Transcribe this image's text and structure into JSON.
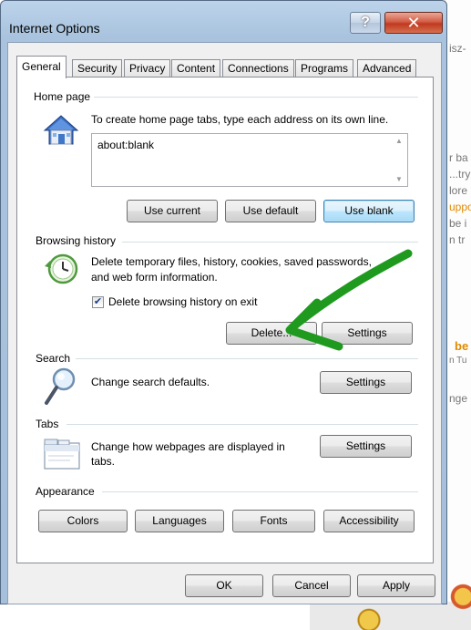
{
  "window": {
    "title": "Internet Options",
    "help_glyph": "?",
    "close_glyph": "✕"
  },
  "tabs": [
    {
      "label": "General",
      "active": true
    },
    {
      "label": "Security"
    },
    {
      "label": "Privacy"
    },
    {
      "label": "Content"
    },
    {
      "label": "Connections"
    },
    {
      "label": "Programs"
    },
    {
      "label": "Advanced"
    }
  ],
  "home_page": {
    "label": "Home page",
    "description": "To create home page tabs, type each address on its own line.",
    "address_value": "about:blank",
    "use_current": "Use current",
    "use_default": "Use default",
    "use_blank": "Use blank"
  },
  "browsing_history": {
    "label": "Browsing history",
    "description_line1": "Delete temporary files, history, cookies, saved passwords,",
    "description_line2": "and web form information.",
    "checkbox_label": "Delete browsing history on exit",
    "checkbox_checked": true,
    "delete": "Delete...",
    "settings": "Settings"
  },
  "search": {
    "label": "Search",
    "description": "Change search defaults.",
    "settings": "Settings"
  },
  "tabs_section": {
    "label": "Tabs",
    "description_line1": "Change how webpages are displayed in",
    "description_line2": "tabs.",
    "settings": "Settings"
  },
  "appearance": {
    "label": "Appearance",
    "colors": "Colors",
    "languages": "Languages",
    "fonts": "Fonts",
    "accessibility": "Accessibility"
  },
  "footer": {
    "ok": "OK",
    "cancel": "Cancel",
    "apply": "Apply"
  },
  "background": {
    "lines": [
      "isz-",
      "r ba",
      "...try",
      "lore",
      "uppo",
      "be i",
      "n tr",
      "be",
      "n Tu",
      "nge"
    ]
  },
  "colors": {
    "annotation_arrow": "#1f9a1f",
    "focused_button_border": "#3c7fb1",
    "close_button": "#c0391f"
  },
  "icons": {
    "home": "house-icon",
    "history": "clock-icon",
    "search": "magnifier-icon",
    "tabs": "tabs-icon"
  }
}
